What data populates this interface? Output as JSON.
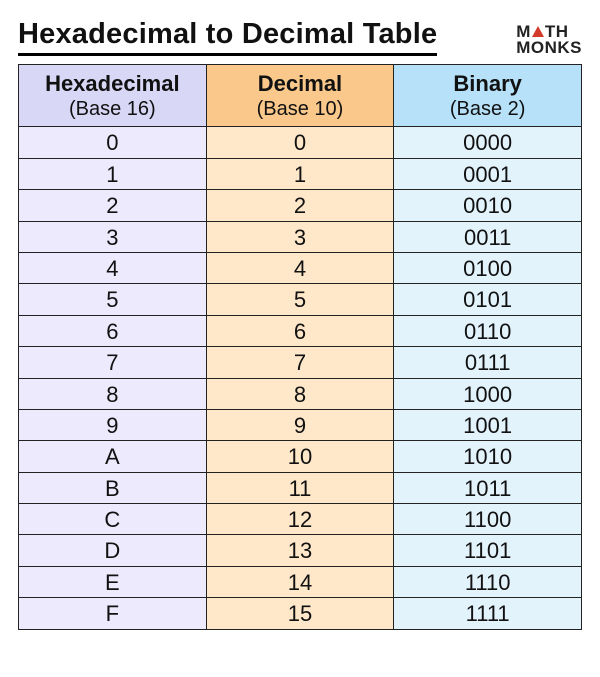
{
  "title": "Hexadecimal to Decimal Table",
  "brand": {
    "line1_left": "M",
    "line1_right": "TH",
    "line2": "MONKS"
  },
  "columns": [
    {
      "name": "Hexadecimal",
      "base": "(Base 16)"
    },
    {
      "name": "Decimal",
      "base": "(Base 10)"
    },
    {
      "name": "Binary",
      "base": "(Base 2)"
    }
  ],
  "rows": [
    {
      "hex": "0",
      "dec": "0",
      "bin": "0000"
    },
    {
      "hex": "1",
      "dec": "1",
      "bin": "0001"
    },
    {
      "hex": "2",
      "dec": "2",
      "bin": "0010"
    },
    {
      "hex": "3",
      "dec": "3",
      "bin": "0011"
    },
    {
      "hex": "4",
      "dec": "4",
      "bin": "0100"
    },
    {
      "hex": "5",
      "dec": "5",
      "bin": "0101"
    },
    {
      "hex": "6",
      "dec": "6",
      "bin": "0110"
    },
    {
      "hex": "7",
      "dec": "7",
      "bin": "0111"
    },
    {
      "hex": "8",
      "dec": "8",
      "bin": "1000"
    },
    {
      "hex": "9",
      "dec": "9",
      "bin": "1001"
    },
    {
      "hex": "A",
      "dec": "10",
      "bin": "1010"
    },
    {
      "hex": "B",
      "dec": "11",
      "bin": "1011"
    },
    {
      "hex": "C",
      "dec": "12",
      "bin": "1100"
    },
    {
      "hex": "D",
      "dec": "13",
      "bin": "1101"
    },
    {
      "hex": "E",
      "dec": "14",
      "bin": "1110"
    },
    {
      "hex": "F",
      "dec": "15",
      "bin": "1111"
    }
  ]
}
